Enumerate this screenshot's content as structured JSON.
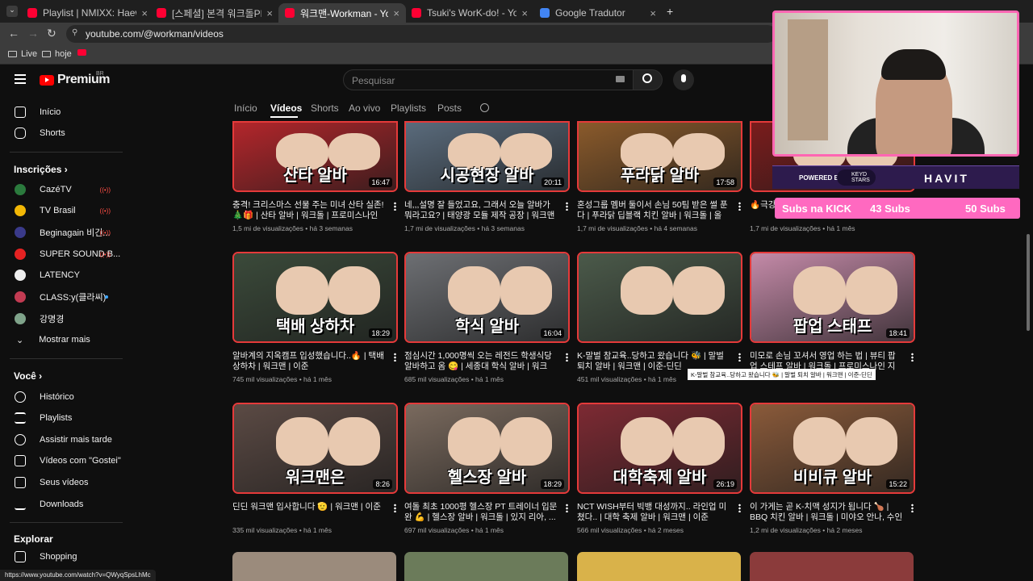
{
  "browser": {
    "tabs": [
      {
        "title": "Playlist | NMIXX: Haewon Work",
        "favicon": "youtube"
      },
      {
        "title": "[스페셜] 본격 워크돌PD 앞담화",
        "favicon": "youtube"
      },
      {
        "title": "워크맨-Workman - YouTube",
        "favicon": "youtube",
        "active": true
      },
      {
        "title": "Tsuki's WorK-do! - YouTube",
        "favicon": "youtube"
      },
      {
        "title": "Google Tradutor",
        "favicon": "google-translate"
      }
    ],
    "new_tab": "+",
    "url": "youtube.com/@workman/videos",
    "bookmarks": [
      "Live",
      "hoje"
    ],
    "status_url": "https://www.youtube.com/watch?v=QWyqSpsLhMc"
  },
  "youtube": {
    "logo_text": "Premium",
    "region": "BR",
    "search_placeholder": "Pesquisar",
    "sidebar": {
      "main": [
        {
          "label": "Início",
          "icon": "home-icon"
        },
        {
          "label": "Shorts",
          "icon": "shorts-icon"
        }
      ],
      "subscriptions_title": "Inscrições",
      "subscriptions": [
        {
          "label": "CazéTV",
          "live": true,
          "color": "#2b7a3d"
        },
        {
          "label": "TV Brasil",
          "live": true,
          "color": "#f2b705"
        },
        {
          "label": "Beginagain 비긴...",
          "live": true,
          "color": "#3a3a8a"
        },
        {
          "label": "SUPER SOUND B...",
          "live": true,
          "color": "#e52222"
        },
        {
          "label": "LATENCY",
          "live": false,
          "color": "#eeeeee"
        },
        {
          "label": "CLASS:y(클라씨)",
          "live": false,
          "new": true,
          "color": "#c23b52"
        },
        {
          "label": "강명경",
          "live": false,
          "color": "#7fa38a"
        }
      ],
      "show_more": "Mostrar mais",
      "you_title": "Você",
      "you": [
        {
          "label": "Histórico",
          "icon": "history-icon"
        },
        {
          "label": "Playlists",
          "icon": "playlists-icon"
        },
        {
          "label": "Assistir mais tarde",
          "icon": "watch-later-icon"
        },
        {
          "label": "Vídeos com \"Gostei\"",
          "icon": "like-icon"
        },
        {
          "label": "Seus vídeos",
          "icon": "your-videos-icon"
        },
        {
          "label": "Downloads",
          "icon": "download-icon"
        }
      ],
      "explore_title": "Explorar",
      "explore": [
        {
          "label": "Shopping",
          "icon": "shopping-icon"
        }
      ]
    },
    "channel_tabs": [
      "Início",
      "Vídeos",
      "Shorts",
      "Ao vivo",
      "Playlists",
      "Posts"
    ],
    "active_tab": "Vídeos",
    "videos": [
      {
        "title": "충격! 크리스마스 선물 주는 미녀 산타 실존! 🎄🎁 | 산타 알바 | 워크돌 | 프로미스나인 ...",
        "views": "1,5 mi de visualizações",
        "age": "há 3 semanas",
        "duration": "16:47",
        "caption": "산타 알바",
        "bg": "#b3262b"
      },
      {
        "title": "네,,,설명 잘 들었고요, 그래서 오늘 알바가 뭐라고요? | 태양광 모듈 제작 공장 | 워크맨 | ...",
        "views": "1,7 mi de visualizações",
        "age": "há 3 semanas",
        "duration": "20:11",
        "caption": "시공현장 알바",
        "bg": "#5a6b7c"
      },
      {
        "title": "혼성그룹 멤버 둘이서 손님 50팀 받은 썰 푼다 | 푸라닭 딥블랙 치킨 알바 | 워크돌 | 올데...",
        "views": "1,7 mi de visualizações",
        "age": "há 4 semanas",
        "duration": "17:58",
        "caption": "푸라닭 알바",
        "bg": "#8a5a2b"
      },
      {
        "title": "🔥극강... 삽 알바",
        "views": "1,7 mi de visualizações",
        "age": "há 1 mês",
        "duration": "",
        "caption": "",
        "bg": "#7a1c1c"
      },
      {
        "title": "알바계의 지옥캠프 입성했습니다..🔥 | 택배 상하차 | 워크맨 | 이준",
        "views": "745 mil visualizações",
        "age": "há 1 mês",
        "duration": "18:29",
        "caption": "택배 상하차",
        "bg": "#3b4a3a"
      },
      {
        "title": "점심시간 1,000명씩 오는 레전드 학생식당 알바하고 옴 😋 | 세종대 학식 알바 | 워크돌...",
        "views": "685 mil visualizações",
        "age": "há 1 mês",
        "duration": "16:04",
        "caption": "학식 알바",
        "bg": "#6d6f73"
      },
      {
        "title": "K-말벌 참교육..당하고 왔습니다 🐝 | 말벌 퇴치 알바 | 워크맨 | 이준-딘딘",
        "views": "451 mil visualizações",
        "age": "há 1 mês",
        "duration": "",
        "caption": "",
        "bg": "#4b5a4a",
        "hovered": true
      },
      {
        "title": "미모로 손님 꼬셔서 영업 하는 법 | 뷰티 팝업 스테프 알바 | 워크돌 | 프로미스나인 지원...",
        "views": "",
        "age": "",
        "duration": "18:41",
        "caption": "팝업 스태프",
        "bg": "#c48aa8"
      },
      {
        "title": "딘딘 워크맨 입사합니다 🫡 | 워크맨 | 이준",
        "views": "335 mil visualizações",
        "age": "há 1 mês",
        "duration": "8:26",
        "caption": "워크맨은",
        "bg": "#5b4a44"
      },
      {
        "title": "여돌 최초 1000평 헬스장 PT 트레이너 입문완 💪 | 헬스장 알바 | 워크돌 | 있지 리아, ...",
        "views": "697 mil visualizações",
        "age": "há 1 mês",
        "duration": "18:29",
        "caption": "헬스장 알바",
        "bg": "#7a6a5e"
      },
      {
        "title": "NCT WISH부터 빅뱅 대성까지.. 라인업 미쳤다.. | 대학 축제 알바 | 워크맨 | 이준",
        "views": "566 mil visualizações",
        "age": "há 2 meses",
        "duration": "26:19",
        "caption": "대학축제 알바",
        "bg": "#7d2a33"
      },
      {
        "title": "이 가게는 곧 K-치맥 성지가 됩니다 🍗 | BBQ 치킨 알바 | 워크돌 | 미야오 안나, 수인",
        "views": "1,2 mi de visualizações",
        "age": "há 2 meses",
        "duration": "15:22",
        "caption": "비비큐 알바",
        "bg": "#8a5a3a"
      }
    ],
    "tooltip": "K-말벌 참교육..당하고 왔습니다 🐝 | 말벌 퇴치 알바 | 워크맨 | 이준-딘딘"
  },
  "overlay": {
    "sponsor_label": "POWERED BY",
    "sponsor_brand": "KEYD STARS",
    "sponsor_brand2": "HAVIT",
    "subs_kick": "Subs na KICK",
    "subs_a": "43 Subs",
    "subs_b": "50 Subs"
  }
}
